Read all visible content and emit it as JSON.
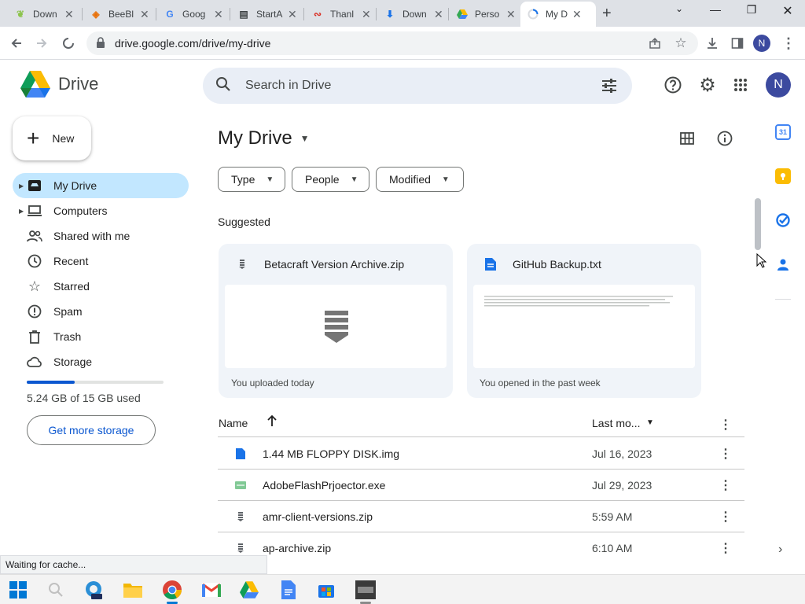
{
  "browser": {
    "tabs": [
      {
        "title": "Down",
        "favicon": "lemon-icon",
        "active": false
      },
      {
        "title": "BeeBl",
        "favicon": "beebox-icon",
        "active": false
      },
      {
        "title": "Goog",
        "favicon": "google-icon",
        "active": false
      },
      {
        "title": "StartA",
        "favicon": "doc-icon",
        "active": false
      },
      {
        "title": "Thanl",
        "favicon": "wave-icon",
        "active": false
      },
      {
        "title": "Down",
        "favicon": "download-icon",
        "active": false
      },
      {
        "title": "Perso",
        "favicon": "drive-icon",
        "active": false
      },
      {
        "title": "My D",
        "favicon": "loading-icon",
        "active": true
      }
    ],
    "url": "drive.google.com/drive/my-drive",
    "profile_initial": "N",
    "status_text": "Waiting for cache..."
  },
  "header": {
    "app_name": "Drive",
    "search_placeholder": "Search in Drive",
    "avatar_initial": "N"
  },
  "sidebar": {
    "new_label": "New",
    "items": [
      {
        "label": "My Drive",
        "icon": "drive-icon",
        "active": true
      },
      {
        "label": "Computers",
        "icon": "computer-icon",
        "active": false
      },
      {
        "label": "Shared with me",
        "icon": "people-icon",
        "active": false
      },
      {
        "label": "Recent",
        "icon": "clock-icon",
        "active": false
      },
      {
        "label": "Starred",
        "icon": "star-icon",
        "active": false
      },
      {
        "label": "Spam",
        "icon": "spam-icon",
        "active": false
      },
      {
        "label": "Trash",
        "icon": "trash-icon",
        "active": false
      },
      {
        "label": "Storage",
        "icon": "cloud-icon",
        "active": false
      }
    ],
    "storage_used_fraction": 0.35,
    "storage_text": "5.24 GB of 15 GB used",
    "get_storage_label": "Get more storage"
  },
  "main": {
    "title": "My Drive",
    "filters": [
      {
        "label": "Type"
      },
      {
        "label": "People"
      },
      {
        "label": "Modified"
      }
    ],
    "suggested_label": "Suggested",
    "suggested": [
      {
        "name": "Betacraft Version Archive.zip",
        "subtitle": "You uploaded today",
        "icon": "zip-icon"
      },
      {
        "name": "GitHub Backup.txt",
        "subtitle": "You opened in the past week",
        "icon": "doc-icon"
      }
    ],
    "columns": {
      "name": "Name",
      "modified": "Last mo..."
    },
    "files": [
      {
        "name": "1.44 MB FLOPPY DISK.img",
        "modified": "Jul 16, 2023",
        "icon": "file-icon"
      },
      {
        "name": "AdobeFlashPrjoector.exe",
        "modified": "Jul 29, 2023",
        "icon": "exe-icon"
      },
      {
        "name": "amr-client-versions.zip",
        "modified": "5:59 AM",
        "icon": "zip-icon"
      },
      {
        "name": "ap-archive.zip",
        "modified": "6:10 AM",
        "icon": "zip-icon"
      }
    ]
  },
  "colors": {
    "accent": "#0b57d0",
    "active_nav": "#c2e7ff",
    "search_bg": "#e9eef6",
    "card_bg": "#f0f4f9"
  }
}
